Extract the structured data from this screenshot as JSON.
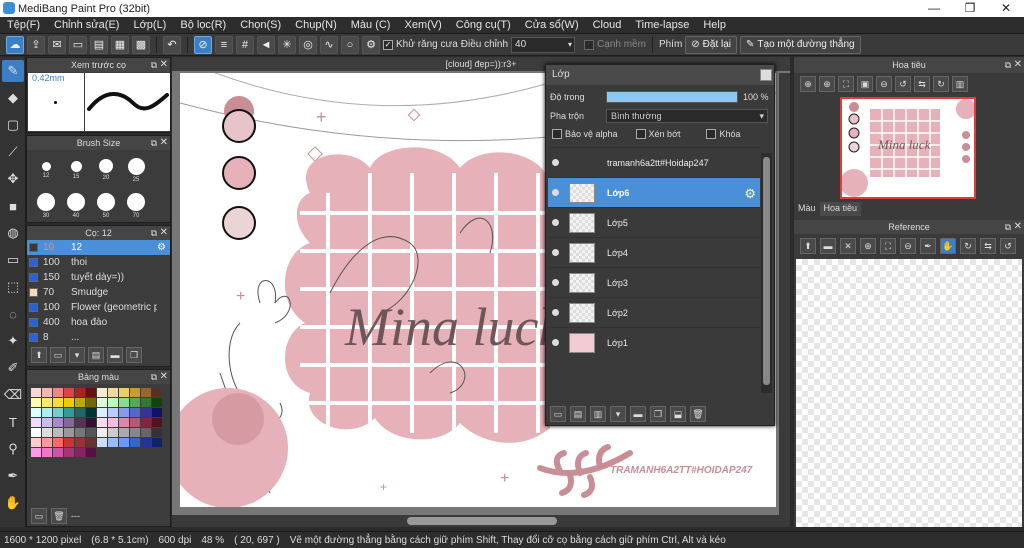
{
  "window": {
    "title": "MediBang Paint Pro (32bit)",
    "controls": [
      "—",
      "❐",
      "✕"
    ]
  },
  "menu": [
    "Tệp(F)",
    "Chỉnh sửa(E)",
    "Lớp(L)",
    "Bộ lọc(R)",
    "Chọn(S)",
    "Chụp(N)",
    "Màu (C)",
    "Xem(V)",
    "Công cụ(T)",
    "Cửa sổ(W)",
    "Cloud",
    "Time-lapse",
    "Help"
  ],
  "toolbar": {
    "antialias_label": "Khử răng cưa",
    "adjust_label": "Điều chỉnh",
    "adjust_value": "40",
    "soft_edge_label": "Cạnh mềm",
    "key_label": "Phím",
    "reset_label": "Đặt lại",
    "straight_line_label": "Tạo một đường thẳng"
  },
  "preview_panel": {
    "title": "Xem trước cọ",
    "size": "0.42mm"
  },
  "brush_size_panel": {
    "title": "Brush Size",
    "sizes": [
      "12",
      "15",
      "20",
      "25",
      "30",
      "40",
      "50",
      "70"
    ]
  },
  "brush_panel": {
    "title": "Cọ: 12",
    "items": [
      {
        "size": "10",
        "name": "12",
        "color": "#3a3a3a"
      },
      {
        "size": "100",
        "name": "thoi",
        "color": "#2a62d6"
      },
      {
        "size": "150",
        "name": "tuyết dày=))",
        "color": "#2a62d6"
      },
      {
        "size": "70",
        "name": "Smudge",
        "color": "#f3d9c0"
      },
      {
        "size": "100",
        "name": "Flower (geometric pa",
        "color": "#2a62d6"
      },
      {
        "size": "400",
        "name": "hoa đào",
        "color": "#2a62d6"
      },
      {
        "size": "8",
        "name": "...",
        "color": "#2a62d6"
      }
    ]
  },
  "palette_panel": {
    "title": "Bảng màu",
    "footer": "---"
  },
  "document": {
    "tab": "[cloud] đẹp=)):r3+",
    "script_text": "Mina luck",
    "signature": "TRAMANH6A2TT#HOIDAP247"
  },
  "layers_panel": {
    "title": "Lớp",
    "opacity_label": "Độ trong",
    "opacity_value": "100 %",
    "opacity": 1.0,
    "blend_label": "Pha trộn",
    "blend_value": "Bình thường",
    "protect_alpha": "Bảo vệ alpha",
    "clip": "Xén bớt",
    "lock": "Khóa",
    "layers": [
      {
        "name": "tramanh6a2tt#Hoidap247",
        "selected": false
      },
      {
        "name": "Lớp6",
        "selected": true
      },
      {
        "name": "Lớp5",
        "selected": false
      },
      {
        "name": "Lớp4",
        "selected": false
      },
      {
        "name": "Lớp3",
        "selected": false
      },
      {
        "name": "Lớp2",
        "selected": false
      },
      {
        "name": "Lớp1",
        "selected": false
      }
    ]
  },
  "navigator": {
    "title": "Hoa tiêu",
    "tabs": [
      "Màu",
      "Hoa tiêu"
    ]
  },
  "reference": {
    "title": "Reference"
  },
  "status": {
    "size": "1600 * 1200 pixel",
    "cm": "(6.8 * 5.1cm)",
    "dpi": "600 dpi",
    "zoom": "48 %",
    "coords": "( 20, 697 )",
    "hint": "Vẽ một đường thẳng bằng cách giữ phím Shift, Thay đổi cỡ cọ bằng cách giữ phím Ctrl, Alt và kéo"
  },
  "colors": {
    "accent": "#3d7fc4",
    "selected_layer": "#4a90d9",
    "pink": "#e6a9b3",
    "dark_pink": "#c4868f"
  }
}
